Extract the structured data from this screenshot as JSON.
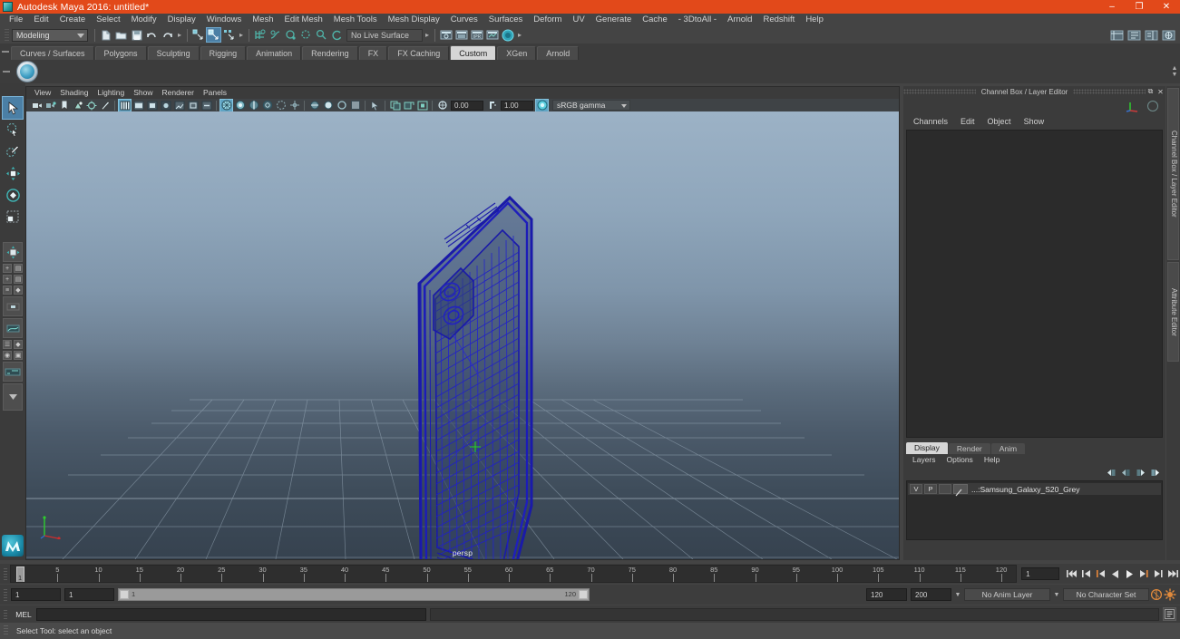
{
  "window": {
    "title": "Autodesk Maya 2016: untitled*",
    "app_icon": "maya-app-icon",
    "controls": {
      "minimize": "–",
      "maximize": "❐",
      "close": "✕"
    }
  },
  "menubar": {
    "items": [
      "File",
      "Edit",
      "Create",
      "Select",
      "Modify",
      "Display",
      "Windows",
      "Mesh",
      "Edit Mesh",
      "Mesh Tools",
      "Mesh Display",
      "Curves",
      "Surfaces",
      "Deform",
      "UV",
      "Generate",
      "Cache",
      "- 3DtoAll -",
      "Arnold",
      "Redshift",
      "Help"
    ]
  },
  "statusbar": {
    "menu_set": "Modeling",
    "live_surface": "No Live Surface",
    "file_icons": [
      "new-scene-icon",
      "open-scene-icon",
      "save-scene-icon",
      "undo-icon",
      "redo-icon"
    ],
    "select_mode_icons": [
      "select-by-hierarchy-icon",
      "select-by-object-type-icon",
      "select-by-component-type-icon"
    ],
    "snap_icons": [
      "snap-to-grid-icon",
      "snap-to-curve-icon",
      "snap-to-point-icon",
      "snap-to-projected-center-icon",
      "snap-to-view-plane-icon",
      "make-live-icon"
    ],
    "render_icons": [
      "render-current-frame-icon",
      "irpr-render-icon",
      "ipr-render-icon",
      "render-settings-icon",
      "hypershade-icon"
    ],
    "right_icons": [
      "show-hide-editors-icon",
      "show-hide-attribute-editor-icon",
      "show-hide-tool-settings-icon",
      "show-hide-channel-box-icon"
    ]
  },
  "shelf": {
    "tabs": [
      "Curves / Surfaces",
      "Polygons",
      "Sculpting",
      "Rigging",
      "Animation",
      "Rendering",
      "FX",
      "FX Caching",
      "Custom",
      "XGen",
      "Arnold"
    ],
    "active_tab": "Custom",
    "items": [
      {
        "name": "custom-shelf-button-1"
      }
    ]
  },
  "toolbox": {
    "tools": [
      {
        "name": "select-tool",
        "icon": "arrow-cursor-icon",
        "active": true
      },
      {
        "name": "lasso-select-tool",
        "icon": "lasso-icon",
        "active": false
      },
      {
        "name": "paint-select-tool",
        "icon": "paint-brush-icon",
        "active": false
      },
      {
        "name": "move-tool",
        "icon": "move-arrows-icon",
        "active": false
      },
      {
        "name": "rotate-tool",
        "icon": "rotate-ring-icon",
        "active": false
      },
      {
        "name": "scale-tool",
        "icon": "scale-box-icon",
        "active": false
      },
      {
        "name": "last-tool-used",
        "icon": "last-tool-icon",
        "active": false
      }
    ],
    "layout_buttons": [
      "single-perspective-view",
      "four-view-layout",
      "two-pane-split",
      "outliner-persp",
      "hypergraph-persp",
      "persp-graph-editor",
      "multi-panel-layout"
    ],
    "logo": "maya-logo"
  },
  "viewport": {
    "menus": [
      "View",
      "Shading",
      "Lighting",
      "Show",
      "Renderer",
      "Panels"
    ],
    "camera_label": "persp",
    "toolbar": {
      "exposure": "0.00",
      "gamma": "1.00",
      "color_space": "sRGB gamma",
      "icons": [
        "select-camera-icon",
        "camera-attributes-icon",
        "bookmarks-icon",
        "image-plane-icon",
        "two-sided-lighting-icon",
        "shadows-icon",
        "wireframe-icon",
        "smooth-shade-all-icon",
        "smooth-shade-textured-icon",
        "use-all-lights-icon",
        "shadows-toggle-icon",
        "screen-space-ao-icon",
        "motion-blur-icon",
        "multisample-aa-icon",
        "depth-of-field-icon",
        "isolate-select-icon",
        "xray-icon",
        "xray-joints-icon",
        "xray-active-components-icon",
        "exposure-icon",
        "gamma-icon",
        "color-management-icon"
      ]
    },
    "model": {
      "name": "Samsung_Galaxy_S20_Grey",
      "display": "wireframe-selected",
      "wire_color": "#1a1aa8"
    },
    "gizmo_axes": [
      "x",
      "y",
      "z"
    ]
  },
  "channel_box": {
    "panel_title": "Channel Box / Layer Editor",
    "menus": [
      "Channels",
      "Edit",
      "Object",
      "Show"
    ],
    "undock_icon": "undock-icon",
    "close_icon": "close-icon"
  },
  "layer_editor": {
    "tabs": [
      "Display",
      "Render",
      "Anim"
    ],
    "active_tab": "Display",
    "menus": [
      "Layers",
      "Options",
      "Help"
    ],
    "buttons": [
      "move-layer-up-icon",
      "move-layer-down-icon",
      "new-layer-icon",
      "new-layer-from-selected-icon"
    ],
    "layers": [
      {
        "visibility": "V",
        "playback": "P",
        "shading": "",
        "name": "...:Samsung_Galaxy_S20_Grey"
      }
    ]
  },
  "vertical_tabs": [
    "Channel Box / Layer Editor",
    "Attribute Editor"
  ],
  "timeline": {
    "start_frame": "1",
    "end_frame": "120",
    "current_frame": "1",
    "ticks": [
      5,
      10,
      15,
      20,
      25,
      30,
      35,
      40,
      45,
      50,
      55,
      60,
      65,
      70,
      75,
      80,
      85,
      90,
      95,
      100,
      105,
      110,
      115,
      120
    ],
    "current_field": "1",
    "playback_buttons": [
      "go-to-start-icon",
      "step-back-keyframe-icon",
      "step-back-frame-icon",
      "play-backwards-icon",
      "play-forwards-icon",
      "step-forward-frame-icon",
      "step-forward-keyframe-icon",
      "go-to-end-icon"
    ]
  },
  "range_slider": {
    "anim_start": "1",
    "range_start": "1",
    "bar_left_label": "1",
    "bar_right_label": "120",
    "range_end": "120",
    "anim_end": "200",
    "anim_layer": "No Anim Layer",
    "character_set": "No Character Set",
    "auto_key_icon": "auto-keyframe-icon",
    "prefs_icon": "animation-preferences-icon"
  },
  "command_line": {
    "language": "MEL",
    "input_value": "",
    "script_editor_icon": "script-editor-icon"
  },
  "help_line": {
    "text": "Select Tool: select an object"
  },
  "colors": {
    "title_bar": "#E2491A",
    "chrome": "#444444",
    "panel": "#3B3B3B",
    "accent_blue": "#4B7FA5",
    "wire_blue": "#1A1AA8",
    "active_tab": "#D6D6D6"
  }
}
